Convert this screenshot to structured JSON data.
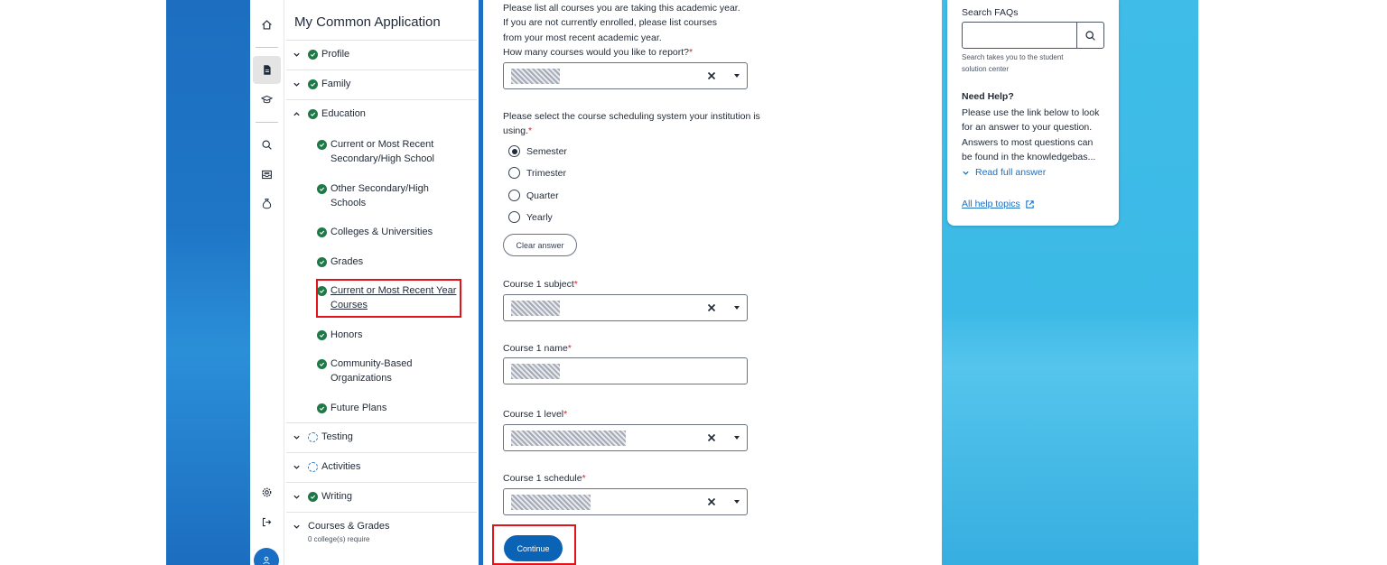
{
  "rail": {
    "icons": [
      "home-icon",
      "document-icon",
      "graduation-cap-icon",
      "search-icon",
      "inbox-icon",
      "money-bag-icon",
      "gear-icon",
      "sign-out-icon",
      "user-icon"
    ]
  },
  "sidebar": {
    "title": "My Common Application",
    "sections": {
      "profile": "Profile",
      "family": "Family",
      "education": "Education",
      "testing": "Testing",
      "activities": "Activities",
      "writing": "Writing",
      "courses_grades": "Courses & Grades",
      "courses_grades_note": "0 college(s) require"
    },
    "education_items": {
      "current_school_1": "Current or Most Recent",
      "current_school_2": "Secondary/High School",
      "other_schools_1": "Other Secondary/High",
      "other_schools_2": "Schools",
      "colleges": "Colleges & Universities",
      "grades": "Grades",
      "current_courses_1": "Current or Most Recent Year",
      "current_courses_2": "Courses",
      "honors": "Honors",
      "community_1": "Community-Based",
      "community_2": "Organizations",
      "future_plans": "Future Plans"
    }
  },
  "form": {
    "intro_1": "Please list all courses you are taking this academic year.",
    "intro_2": "If you are not currently enrolled, please list courses",
    "intro_3": "from your most recent academic year.",
    "count_label": "How many courses would you like to report?",
    "scheduling_label_1": "Please select the course scheduling system your institution is",
    "scheduling_label_2": "using.",
    "options": {
      "semester": "Semester",
      "trimester": "Trimester",
      "quarter": "Quarter",
      "yearly": "Yearly"
    },
    "selected_option": "Semester",
    "clear_label": "Clear answer",
    "subject_label": "Course 1 subject",
    "name_label": "Course 1 name",
    "level_label": "Course 1 level",
    "schedule_label": "Course 1 schedule",
    "required_mark": "*",
    "continue_label": "Continue"
  },
  "help": {
    "search_label": "Search FAQs",
    "search_note_1": "Search takes you to the student",
    "search_note_2": "solution center",
    "need_help": "Need Help?",
    "help_text_1": "Please use the link below to look",
    "help_text_2": "for an answer to your question.",
    "help_text_3": "Answers to most questions can",
    "help_text_4": "be found in the knowledgebas...",
    "read_full": "Read full answer",
    "all_topics": "All help topics"
  },
  "colors": {
    "brand_blue": "#0b63b5",
    "success_green": "#1d7a47",
    "required_red": "#d1242f",
    "highlight_red": "#e1141b"
  }
}
